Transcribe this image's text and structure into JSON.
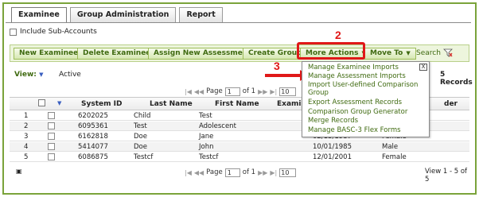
{
  "tabs": [
    "Examinee",
    "Group Administration",
    "Report"
  ],
  "include_sub_accounts": "Include Sub-Accounts",
  "toolbar": {
    "new_examinee": "New Examinee",
    "delete_examinee": "Delete Examinee",
    "assign_assessment": "Assign New Assessment",
    "create_group": "Create Group",
    "more_actions": "More Actions",
    "move_to": "Move To",
    "search": "Search"
  },
  "annotations": {
    "step2": "2",
    "step3": "3"
  },
  "view": {
    "label": "View:",
    "filter": "Active",
    "records": "5 Records"
  },
  "pager": {
    "page_label": "Page",
    "page": "1",
    "of": "of 1",
    "per_page": "10",
    "view_range": "View 1 - 5 of 5"
  },
  "columns": {
    "system_id": "System ID",
    "last_name": "Last Name",
    "first_name": "First Name",
    "examinee": "Examine",
    "gender": "der"
  },
  "rows": [
    {
      "n": "1",
      "id": "6202025",
      "last": "Child",
      "first": "Test",
      "dob": "",
      "gender": ""
    },
    {
      "n": "2",
      "id": "6095361",
      "last": "Test",
      "first": "Adolescent",
      "dob": "",
      "gender": ""
    },
    {
      "n": "3",
      "id": "6162818",
      "last": "Doe",
      "first": "Jane",
      "dob": "02/15/1987",
      "gender": "Female"
    },
    {
      "n": "4",
      "id": "5414077",
      "last": "Doe",
      "first": "John",
      "dob": "10/01/1985",
      "gender": "Male"
    },
    {
      "n": "5",
      "id": "6086875",
      "last": "Testcf",
      "first": "Testcf",
      "dob": "12/01/2001",
      "gender": "Female"
    }
  ],
  "more_actions_menu": {
    "close": "X",
    "items": [
      "Manage Examinee Imports",
      "Manage Assessment Imports",
      "Import User-defined Comparison",
      "Group",
      "Export Assessment Records",
      "Comparison Group Generator",
      "Merge Records",
      "Manage BASC-3 Flex Forms"
    ]
  },
  "colors": {
    "accent_green": "#3f6a10",
    "annotation_red": "#e01818",
    "toolbar_bg": "#edf5dd"
  }
}
